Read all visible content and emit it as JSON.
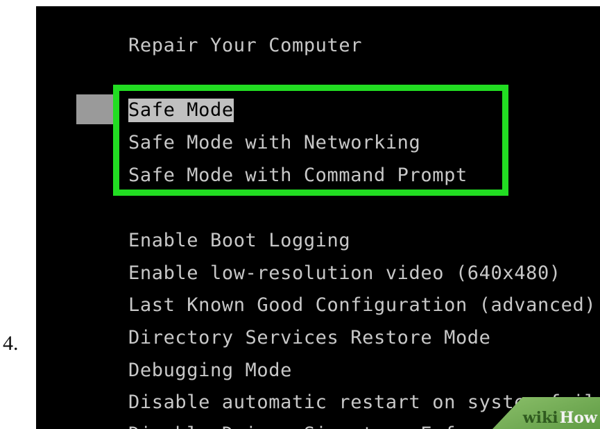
{
  "step": {
    "number": "4."
  },
  "boot_menu": {
    "title": "Repair Your Computer",
    "highlighted_options": [
      "Safe Mode",
      "Safe Mode with Networking",
      "Safe Mode with Command Prompt"
    ],
    "selected_index": 0,
    "other_options": [
      "Enable Boot Logging",
      "Enable low-resolution video (640x480)",
      "Last Known Good Configuration (advanced)",
      "Directory Services Restore Mode",
      "Debugging Mode",
      "Disable automatic restart on system failure",
      "Disable Driver Signature Enforcement"
    ]
  },
  "watermark": {
    "part1": "wiki",
    "part2": "How"
  },
  "colors": {
    "screen_bg": "#000000",
    "text": "#c8c8c8",
    "selection_bg": "#c0c0c0",
    "highlight_border": "#22dd22",
    "watermark": "#6fa84f"
  }
}
